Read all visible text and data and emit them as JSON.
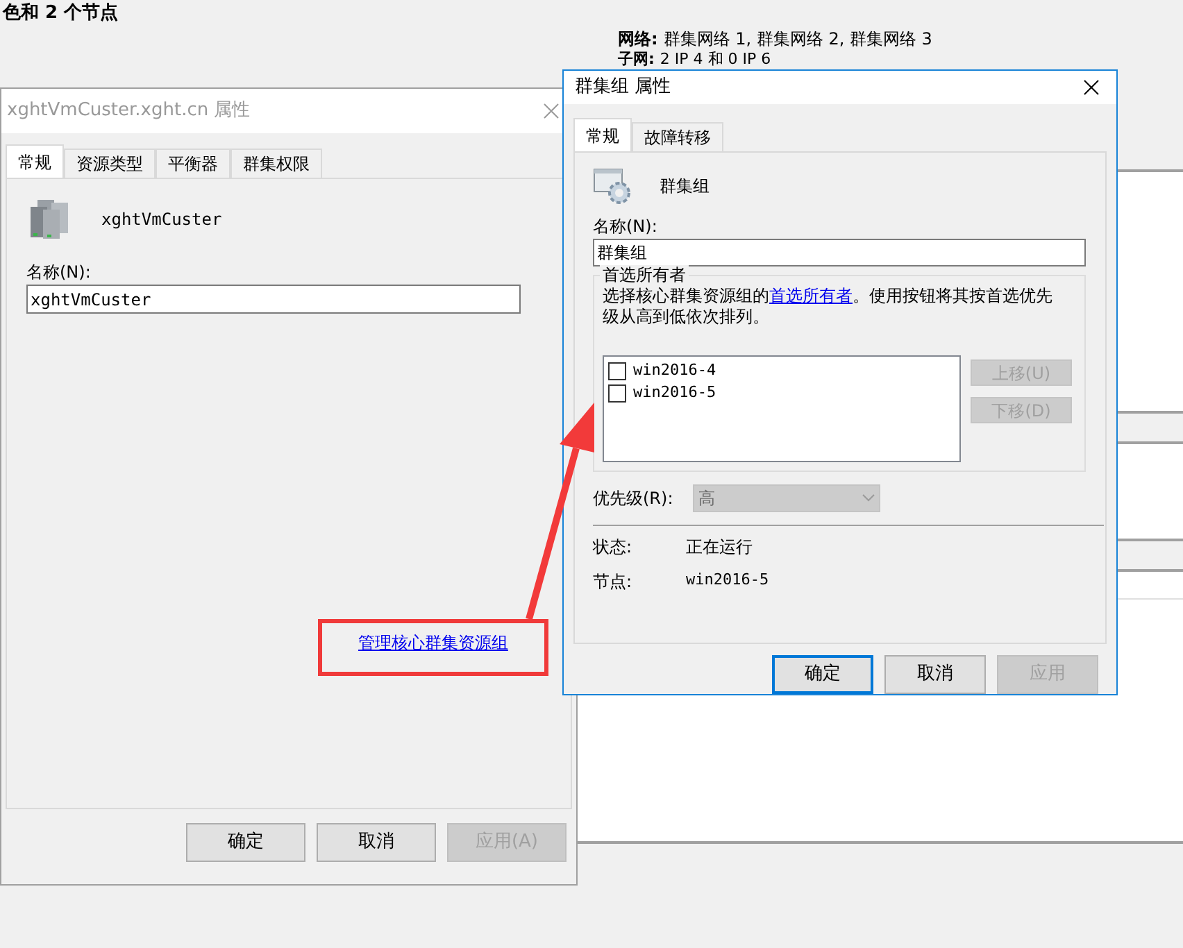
{
  "background": {
    "heading": "色和 2 个节点",
    "networks_label": "网络:",
    "networks_value": "群集网络 1, 群集网络 2, 群集网络 3",
    "subnet_label": "子网:",
    "subnet_value": "2 IP 4 和 0 IP 6"
  },
  "cluster_dialog": {
    "title": "xghtVmCuster.xght.cn 属性",
    "active": false,
    "tabs": [
      {
        "label": "常规",
        "selected": true
      },
      {
        "label": "资源类型",
        "selected": false
      },
      {
        "label": "平衡器",
        "selected": false
      },
      {
        "label": "群集权限",
        "selected": false
      }
    ],
    "object_name": "xghtVmCuster",
    "name_label": "名称(N):",
    "name_value": "xghtVmCuster",
    "link": "管理核心群集资源组",
    "buttons": [
      {
        "label": "确定",
        "disabled": false,
        "default": false
      },
      {
        "label": "取消",
        "disabled": false,
        "default": false
      },
      {
        "label": "应用(A)",
        "disabled": true,
        "default": false
      }
    ]
  },
  "group_dialog": {
    "title": "群集组 属性",
    "active": true,
    "tabs": [
      {
        "label": "常规",
        "selected": true
      },
      {
        "label": "故障转移",
        "selected": false
      }
    ],
    "object_name": "群集组",
    "name_label": "名称(N):",
    "name_value": "群集组",
    "owners_group": {
      "title": "首选所有者",
      "text_before": "选择核心群集资源组的",
      "link": "首选所有者",
      "text_after": "。使用按钮将其按首选优先级从高到低依次排列。",
      "owners": [
        {
          "name": "win2016-4",
          "checked": false
        },
        {
          "name": "win2016-5",
          "checked": false
        }
      ],
      "move_buttons": [
        {
          "label": "上移(U)",
          "disabled": true
        },
        {
          "label": "下移(D)",
          "disabled": true
        }
      ]
    },
    "priority": {
      "label": "优先级(R):",
      "value": "高",
      "disabled": true
    },
    "status_label": "状态:",
    "status_value": "正在运行",
    "node_label": "节点:",
    "node_value": "win2016-5",
    "buttons": [
      {
        "label": "确定",
        "disabled": false,
        "default": true
      },
      {
        "label": "取消",
        "disabled": false,
        "default": false
      },
      {
        "label": "应用",
        "disabled": true,
        "default": false
      }
    ]
  }
}
